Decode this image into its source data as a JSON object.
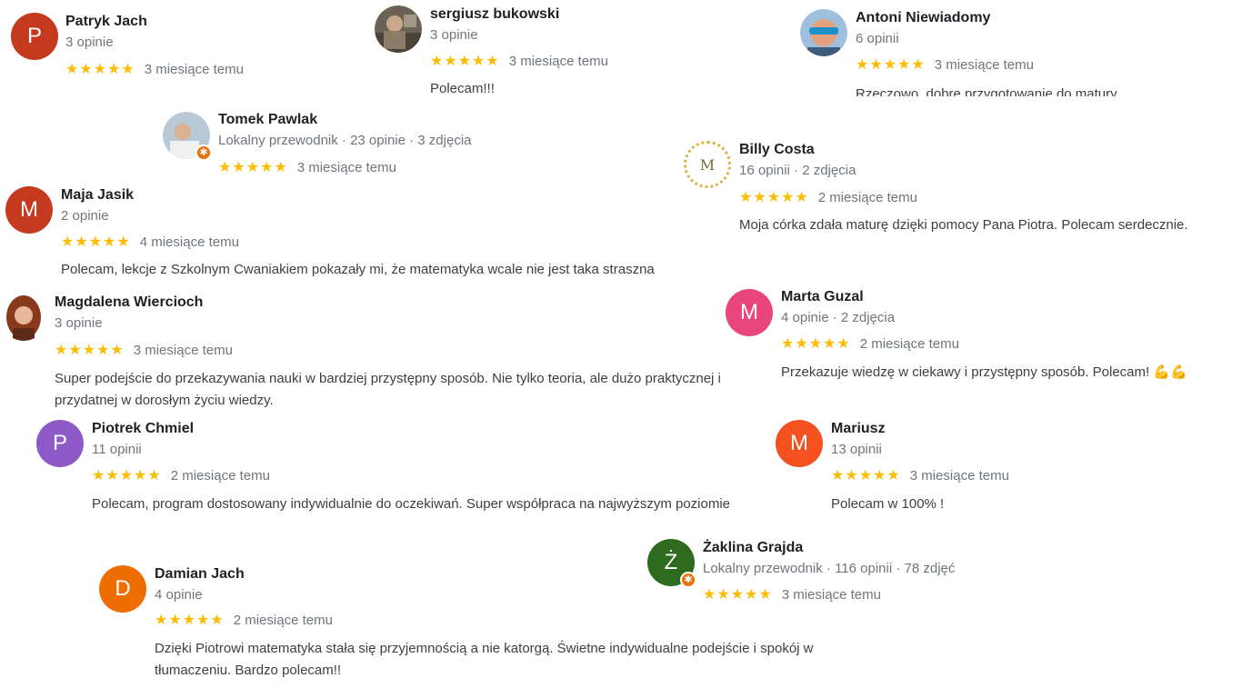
{
  "reviews": [
    {
      "name": "Patryk Jach",
      "meta": "3 opinie",
      "stars": "★★★★★",
      "time": "3 miesiące temu",
      "initial": "P",
      "color": "#c5391e",
      "text": ""
    },
    {
      "name": "sergiusz bukowski",
      "meta": "3 opinie",
      "stars": "★★★★★",
      "time": "3 miesiące temu",
      "text": "Polecam!!!"
    },
    {
      "name": "Antoni Niewiadomy",
      "meta": "6 opinii",
      "stars": "★★★★★",
      "time": "3 miesiące temu",
      "text": "Rzeczowo, dobre przygotowanie do matury"
    },
    {
      "name": "Tomek Pawlak",
      "meta": "Lokalny przewodnik · 23 opinie · 3 zdjęcia",
      "stars": "★★★★★",
      "time": "3 miesiące temu",
      "text": ""
    },
    {
      "name": "Billy Costa",
      "meta": "16 opinii · 2 zdjęcia",
      "stars": "★★★★★",
      "time": "2 miesiące temu",
      "initial": "M",
      "text": "Moja córka zdała maturę dzięki pomocy Pana Piotra. Polecam serdecznie."
    },
    {
      "name": "Maja Jasik",
      "meta": "2 opinie",
      "stars": "★★★★★",
      "time": "4 miesiące temu",
      "initial": "M",
      "color": "#c5391e",
      "text": "Polecam, lekcje z Szkolnym Cwaniakiem pokazały mi, że matematyka wcale nie jest taka straszna"
    },
    {
      "name": "Magdalena Wiercioch",
      "meta": "3 opinie",
      "stars": "★★★★★",
      "time": "3 miesiące temu",
      "text": "Super podejście do przekazywania nauki w bardziej przystępny sposób. Nie tylko teoria, ale dużo praktycznej i przydatnej w dorosłym życiu wiedzy."
    },
    {
      "name": "Marta Guzal",
      "meta": "4 opinie · 2 zdjęcia",
      "stars": "★★★★★",
      "time": "2 miesiące temu",
      "initial": "M",
      "color": "#e8457c",
      "text": "Przekazuje wiedzę w ciekawy i przystępny sposób. Polecam! 💪💪"
    },
    {
      "name": "Piotrek Chmiel",
      "meta": "11 opinii",
      "stars": "★★★★★",
      "time": "2 miesiące temu",
      "initial": "P",
      "color": "#8e5ac8",
      "text": "Polecam, program dostosowany indywidualnie do oczekiwań. Super współpraca na najwyższym poziomie"
    },
    {
      "name": "Mariusz",
      "meta": "13 opinii",
      "stars": "★★★★★",
      "time": "3 miesiące temu",
      "initial": "M",
      "color": "#f4511e",
      "text": "Polecam w 100% !"
    },
    {
      "name": "Żaklina Grajda",
      "meta": "Lokalny przewodnik · 116 opinii · 78 zdjęć",
      "stars": "★★★★★",
      "time": "3 miesiące temu",
      "initial": "Ż",
      "color": "#2e6b1f",
      "text": ""
    },
    {
      "name": "Damian Jach",
      "meta": "4 opinie",
      "stars": "★★★★★",
      "time": "2 miesiące temu",
      "initial": "D",
      "color": "#ef6c00",
      "text": "Dzięki Piotrowi matematyka stała się przyjemnością a nie katorgą. Świetne indywidualne podejście i spokój w tłumaczeniu. Bardzo polecam!!"
    }
  ]
}
